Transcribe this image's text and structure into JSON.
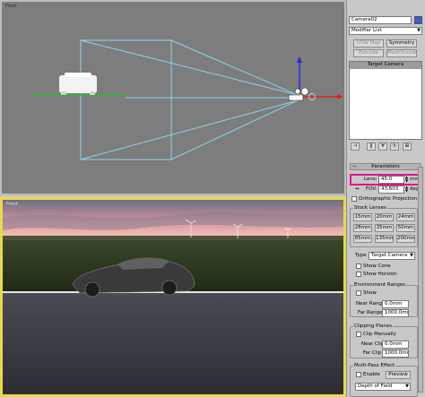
{
  "viewports": {
    "top": {
      "label": "Front"
    },
    "camera": {
      "label": "Front"
    }
  },
  "panel": {
    "object_name": "Camera02",
    "modifier_list": "Modifier List",
    "mod_buttons": [
      "UVW Map",
      "Symmetry",
      "Extrude",
      "MeshSmooth"
    ],
    "stack_item": "Target Camera",
    "parameters_title": "Parameters",
    "lens_label": "Lens:",
    "lens_value": "45.0",
    "lens_unit": "mm",
    "fov_label": "FOV:",
    "fov_value": "43.603",
    "fov_unit": "deg.",
    "ortho_label": "Orthographic Projection",
    "stock_lenses_title": "Stock Lenses",
    "stock_lenses": [
      "15mm",
      "20mm",
      "24mm",
      "28mm",
      "35mm",
      "50mm",
      "85mm",
      "135mm",
      "200mm"
    ],
    "type_label": "Type",
    "type_value": "Target Camera",
    "show_cone": "Show Cone",
    "show_horizon": "Show Horizon",
    "env_ranges_title": "Environment Ranges",
    "env_show": "Show",
    "near_range_label": "Near Range:",
    "near_range_value": "0.0mm",
    "far_range_label": "Far Range:",
    "far_range_value": "1000.0mm",
    "clipping_title": "Clipping Planes",
    "clip_manually": "Clip Manually",
    "near_clip_label": "Near Clip:",
    "near_clip_value": "0.0mm",
    "far_clip_label": "Far Clip:",
    "far_clip_value": "1000.0mm",
    "multipass_title": "Multi-Pass Effect",
    "enable_label": "Enable",
    "preview_label": "Preview",
    "effect_value": "Depth of Field"
  },
  "colors": {
    "highlight": "#e0148c",
    "active_border": "#e8d94a",
    "frustum": "#8fd3e6"
  }
}
